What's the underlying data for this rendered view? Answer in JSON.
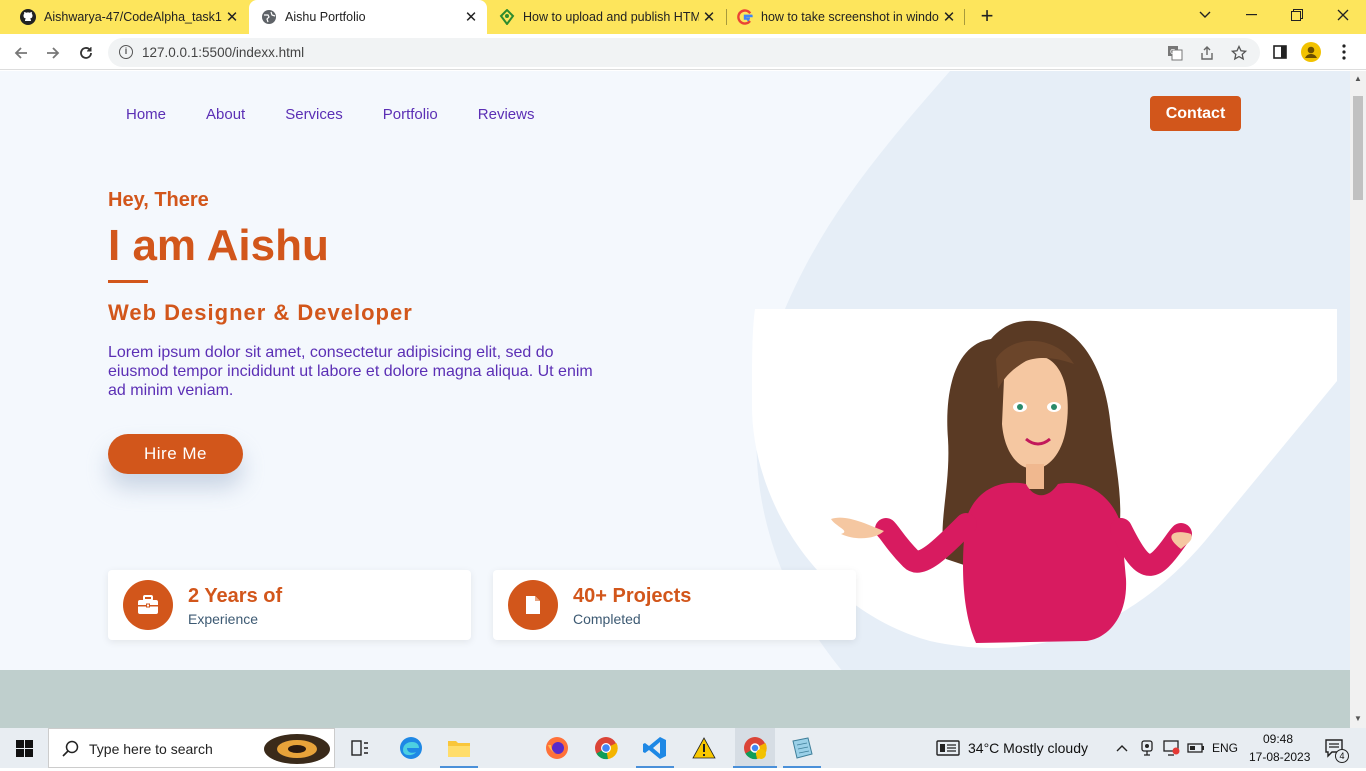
{
  "browser": {
    "tabs": [
      {
        "title": "Aishwarya-47/CodeAlpha_task1",
        "icon": "github-icon"
      },
      {
        "title": "Aishu Portfolio",
        "icon": "globe-icon"
      },
      {
        "title": "How to upload and publish HTML",
        "icon": "diamond-icon"
      },
      {
        "title": "how to take screenshot in windo",
        "icon": "google-icon"
      }
    ],
    "url": "127.0.0.1:5500/indexx.html"
  },
  "page": {
    "nav": [
      "Home",
      "About",
      "Services",
      "Portfolio",
      "Reviews"
    ],
    "contact_label": "Contact",
    "greeting": "Hey, There",
    "headline": "I am Aishu",
    "role": "Web Designer & Developer",
    "intro": "Lorem ipsum dolor sit amet, consectetur adipisicing elit, sed do eiusmod tempor incididunt ut labore et dolore magna aliqua. Ut enim ad minim veniam.",
    "hire_label": "Hire Me",
    "stats": [
      {
        "title": "2 Years of",
        "subtitle": "Experience",
        "icon": "briefcase-icon"
      },
      {
        "title": "40+ Projects",
        "subtitle": "Completed",
        "icon": "file-icon"
      }
    ],
    "colors": {
      "accent": "#d2561b",
      "link": "#5b2fb5",
      "background": "#f4f8fd"
    }
  },
  "taskbar": {
    "search_placeholder": "Type here to search",
    "weather": "34°C  Mostly cloudy",
    "language": "ENG",
    "time": "09:48",
    "date": "17-08-2023",
    "notifications": "4"
  }
}
